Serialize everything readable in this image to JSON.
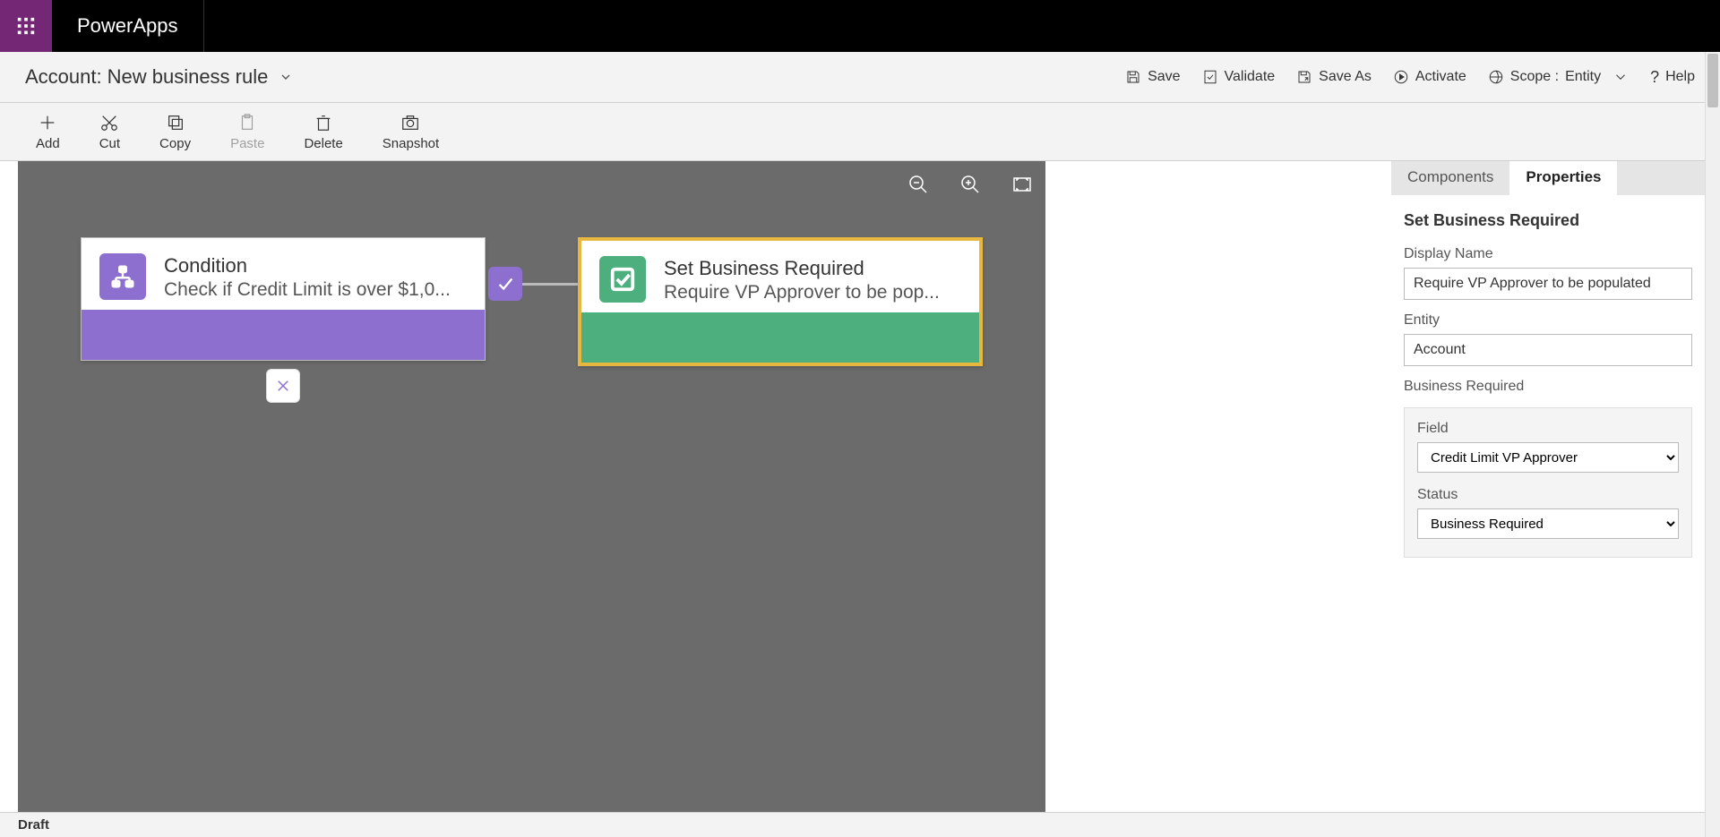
{
  "app": {
    "name": "PowerApps"
  },
  "breadcrumb": {
    "entity": "Account:",
    "name": "New business rule"
  },
  "actions": {
    "save": "Save",
    "validate": "Validate",
    "saveas": "Save As",
    "activate": "Activate",
    "scope_label": "Scope :",
    "scope_value": "Entity",
    "help": "Help"
  },
  "toolbar": {
    "add": "Add",
    "cut": "Cut",
    "copy": "Copy",
    "paste": "Paste",
    "delete": "Delete",
    "snapshot": "Snapshot"
  },
  "canvas": {
    "condition": {
      "title": "Condition",
      "subtitle": "Check if Credit Limit is over $1,0..."
    },
    "action": {
      "title": "Set Business Required",
      "subtitle": "Require VP Approver to be pop..."
    }
  },
  "panel": {
    "tabs": {
      "components": "Components",
      "properties": "Properties"
    },
    "title": "Set Business Required",
    "display_name_label": "Display Name",
    "display_name_value": "Require VP Approver to be populated",
    "entity_label": "Entity",
    "entity_value": "Account",
    "section_label": "Business Required",
    "field_label": "Field",
    "field_value": "Credit Limit VP Approver",
    "status_label": "Status",
    "status_value": "Business Required"
  },
  "status": "Draft"
}
